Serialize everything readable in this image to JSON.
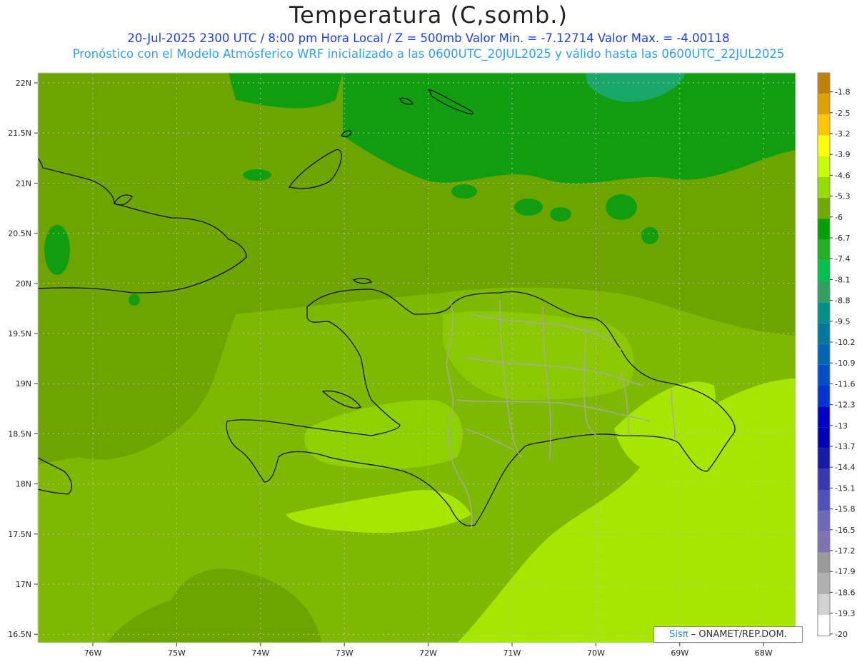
{
  "header": {
    "title": "Temperatura (C,somb.)",
    "line1": "20-Jul-2025   2300 UTC / 8:00 pm Hora Local / Z = 500mb  Valor Min. = -7.12714  Valor Max. = -4.00118",
    "line2": "Pronóstico con el Modelo Atmósferico WRF inicializado a las 0600UTC_20JUL2025 y válido hasta las  0600UTC_22JUL2025"
  },
  "map": {
    "lat_labels": [
      "22N",
      "21.5N",
      "21N",
      "20.5N",
      "20N",
      "19.5N",
      "19N",
      "18.5N",
      "18N",
      "17.5N",
      "17N",
      "16.5N"
    ],
    "lon_labels": [
      "76W",
      "75W",
      "74W",
      "73W",
      "72W",
      "71W",
      "70W",
      "69W",
      "68W"
    ]
  },
  "colorbar": {
    "levels": [
      "-1.8",
      "-2.5",
      "-3.2",
      "-3.9",
      "-4.6",
      "-5.3",
      "-6",
      "-6.7",
      "-7.4",
      "-8.1",
      "-8.8",
      "-9.5",
      "-10.2",
      "-10.9",
      "-11.6",
      "-12.3",
      "-13",
      "-13.7",
      "-14.4",
      "-15.1",
      "-15.8",
      "-16.5",
      "-17.2",
      "-17.9",
      "-18.6",
      "-19.3",
      "-20"
    ],
    "colors": [
      "#c08000",
      "#e0a000",
      "#ffc800",
      "#ffff00",
      "#c8ff00",
      "#96dc00",
      "#6eaa00",
      "#00a000",
      "#20b020",
      "#00c050",
      "#30a060",
      "#00908a",
      "#007a9a",
      "#0066b4",
      "#004fc8",
      "#0034d2",
      "#0000c8",
      "#0000b4",
      "#1a1aa8",
      "#3838b0",
      "#5050b8",
      "#6a6ab8",
      "#8070b4",
      "#9a9a9a",
      "#b0b0b0",
      "#d2d2d2",
      "#ffffff"
    ]
  },
  "credit": {
    "brand": "Sisπ",
    "text": "– ONAMET/REP.DOM."
  }
}
